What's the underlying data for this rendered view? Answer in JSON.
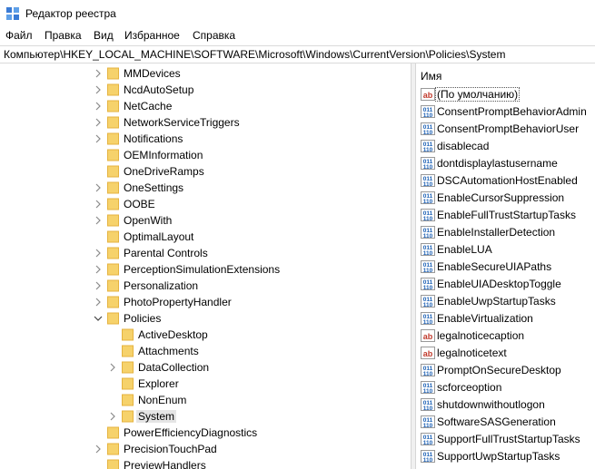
{
  "window": {
    "title": "Редактор реестра"
  },
  "menu": [
    "Файл",
    "Правка",
    "Вид",
    "Избранное",
    "Справка"
  ],
  "address": "Компьютер\\HKEY_LOCAL_MACHINE\\SOFTWARE\\Microsoft\\Windows\\CurrentVersion\\Policies\\System",
  "tree": [
    {
      "label": "MMDevices",
      "level": 1,
      "expander": "collapsed"
    },
    {
      "label": "NcdAutoSetup",
      "level": 1,
      "expander": "collapsed"
    },
    {
      "label": "NetCache",
      "level": 1,
      "expander": "collapsed"
    },
    {
      "label": "NetworkServiceTriggers",
      "level": 1,
      "expander": "collapsed"
    },
    {
      "label": "Notifications",
      "level": 1,
      "expander": "collapsed"
    },
    {
      "label": "OEMInformation",
      "level": 1,
      "expander": "none"
    },
    {
      "label": "OneDriveRamps",
      "level": 1,
      "expander": "none"
    },
    {
      "label": "OneSettings",
      "level": 1,
      "expander": "collapsed"
    },
    {
      "label": "OOBE",
      "level": 1,
      "expander": "collapsed"
    },
    {
      "label": "OpenWith",
      "level": 1,
      "expander": "collapsed"
    },
    {
      "label": "OptimalLayout",
      "level": 1,
      "expander": "none"
    },
    {
      "label": "Parental Controls",
      "level": 1,
      "expander": "collapsed"
    },
    {
      "label": "PerceptionSimulationExtensions",
      "level": 1,
      "expander": "collapsed"
    },
    {
      "label": "Personalization",
      "level": 1,
      "expander": "collapsed"
    },
    {
      "label": "PhotoPropertyHandler",
      "level": 1,
      "expander": "collapsed"
    },
    {
      "label": "Policies",
      "level": 1,
      "expander": "expanded"
    },
    {
      "label": "ActiveDesktop",
      "level": 2,
      "expander": "none"
    },
    {
      "label": "Attachments",
      "level": 2,
      "expander": "none"
    },
    {
      "label": "DataCollection",
      "level": 2,
      "expander": "collapsed"
    },
    {
      "label": "Explorer",
      "level": 2,
      "expander": "none"
    },
    {
      "label": "NonEnum",
      "level": 2,
      "expander": "none"
    },
    {
      "label": "System",
      "level": 2,
      "expander": "collapsed",
      "selected": true
    },
    {
      "label": "PowerEfficiencyDiagnostics",
      "level": 1,
      "expander": "none"
    },
    {
      "label": "PrecisionTouchPad",
      "level": 1,
      "expander": "collapsed"
    },
    {
      "label": "PreviewHandlers",
      "level": 1,
      "expander": "none"
    }
  ],
  "list": {
    "column_name": "Имя",
    "items": [
      {
        "name": "(По умолчанию)",
        "type": "string",
        "focused": true
      },
      {
        "name": "ConsentPromptBehaviorAdmin",
        "type": "dword"
      },
      {
        "name": "ConsentPromptBehaviorUser",
        "type": "dword"
      },
      {
        "name": "disablecad",
        "type": "dword"
      },
      {
        "name": "dontdisplaylastusername",
        "type": "dword"
      },
      {
        "name": "DSCAutomationHostEnabled",
        "type": "dword"
      },
      {
        "name": "EnableCursorSuppression",
        "type": "dword"
      },
      {
        "name": "EnableFullTrustStartupTasks",
        "type": "dword"
      },
      {
        "name": "EnableInstallerDetection",
        "type": "dword"
      },
      {
        "name": "EnableLUA",
        "type": "dword"
      },
      {
        "name": "EnableSecureUIAPaths",
        "type": "dword"
      },
      {
        "name": "EnableUIADesktopToggle",
        "type": "dword"
      },
      {
        "name": "EnableUwpStartupTasks",
        "type": "dword"
      },
      {
        "name": "EnableVirtualization",
        "type": "dword"
      },
      {
        "name": "legalnoticecaption",
        "type": "string"
      },
      {
        "name": "legalnoticetext",
        "type": "string"
      },
      {
        "name": "PromptOnSecureDesktop",
        "type": "dword"
      },
      {
        "name": "scforceoption",
        "type": "dword"
      },
      {
        "name": "shutdownwithoutlogon",
        "type": "dword"
      },
      {
        "name": "SoftwareSASGeneration",
        "type": "dword"
      },
      {
        "name": "SupportFullTrustStartupTasks",
        "type": "dword"
      },
      {
        "name": "SupportUwpStartupTasks",
        "type": "dword"
      }
    ]
  },
  "colors": {
    "folder": "#f6d26b",
    "folder_dark": "#e5b33f",
    "selection": "#e5e5e5",
    "dword_icon": "#1a5fb4",
    "string_icon": "#c0392b"
  },
  "icons": {
    "app": "registry-editor-icon",
    "folder": "folder-icon",
    "dword": "reg-dword-icon",
    "string": "reg-string-icon",
    "collapsed": "chevron-right-icon",
    "expanded": "chevron-down-icon"
  }
}
